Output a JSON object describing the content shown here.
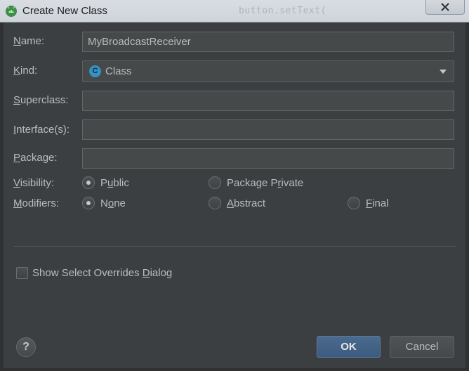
{
  "window": {
    "title": "Create New Class",
    "background_text": "button.setText("
  },
  "form": {
    "name_label": "ame:",
    "name_mnemonic": "N",
    "name_value": "MyBroadcastReceiver",
    "kind_label": "ind:",
    "kind_mnemonic": "K",
    "kind_value": "Class",
    "kind_icon_letter": "C",
    "superclass_label": "uperclass:",
    "superclass_mnemonic": "S",
    "superclass_value": "",
    "interfaces_label": "nterface(s):",
    "interfaces_mnemonic": "I",
    "interfaces_value": "",
    "package_label": "ackage:",
    "package_mnemonic": "P",
    "package_value": "",
    "visibility_label": "isibility:",
    "visibility_mnemonic": "V",
    "modifiers_label": "odifiers:",
    "modifiers_mnemonic": "M"
  },
  "visibility_options": {
    "public": {
      "before": "P",
      "mnemonic": "u",
      "after": "blic",
      "selected": true
    },
    "package_private": {
      "before": "Package P",
      "mnemonic": "r",
      "after": "ivate",
      "selected": false
    }
  },
  "modifier_options": {
    "none": {
      "before": "N",
      "mnemonic": "o",
      "after": "ne",
      "selected": true
    },
    "abstract": {
      "before": "",
      "mnemonic": "A",
      "after": "bstract",
      "selected": false
    },
    "final": {
      "before": "",
      "mnemonic": "F",
      "after": "inal",
      "selected": false
    }
  },
  "overrides": {
    "before": "Show Select Overrides ",
    "mnemonic": "D",
    "after": "ialog",
    "checked": false
  },
  "buttons": {
    "help": "?",
    "ok": "OK",
    "cancel": "Cancel"
  },
  "colors": {
    "dialog_bg": "#3c3f41",
    "field_bg": "#45494a",
    "ok_bg": "#3d5b7e",
    "class_icon": "#3592c4"
  }
}
